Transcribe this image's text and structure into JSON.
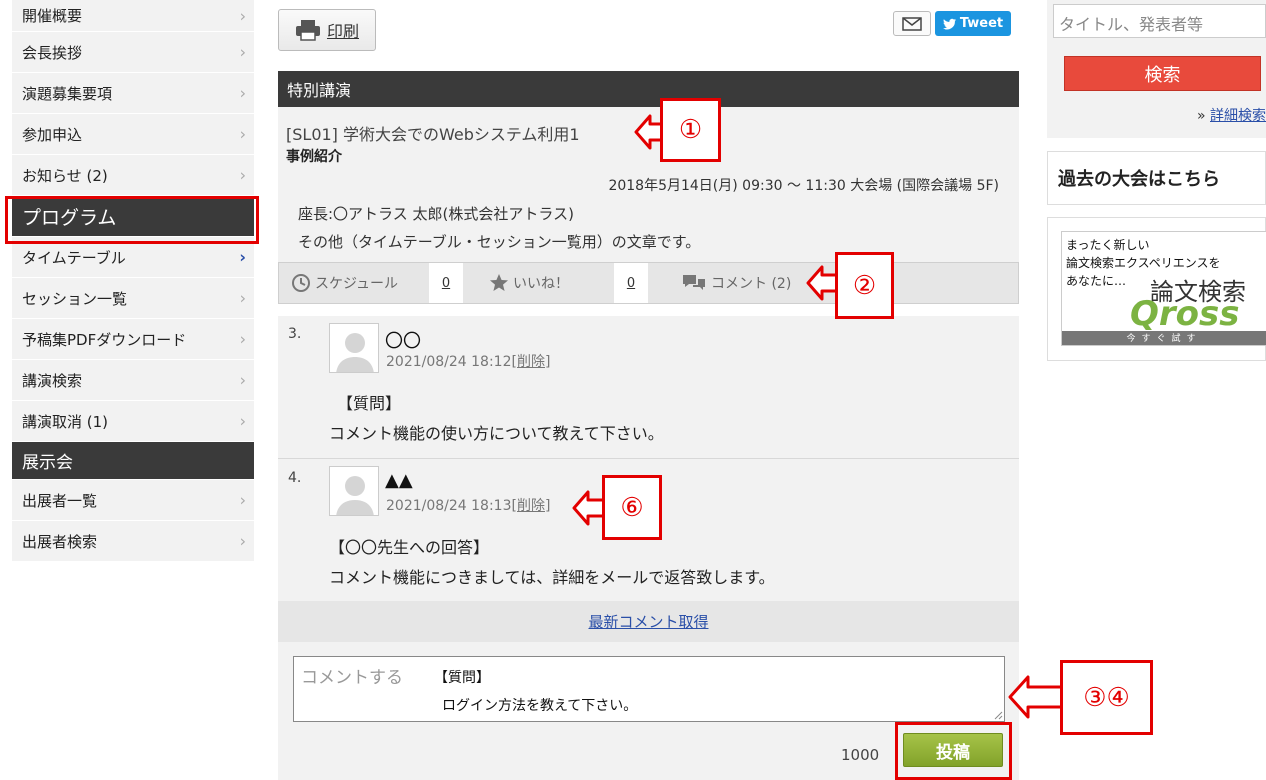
{
  "sidebar": {
    "items": [
      {
        "label": "開催概要"
      },
      {
        "label": "会長挨拶"
      },
      {
        "label": "演題募集要項"
      },
      {
        "label": "参加申込"
      },
      {
        "label": "お知らせ (2)"
      },
      {
        "label": "プログラム"
      },
      {
        "label": "タイムテーブル"
      },
      {
        "label": "セッション一覧"
      },
      {
        "label": "予稿集PDFダウンロード"
      },
      {
        "label": "講演検索"
      },
      {
        "label": "講演取消 (1)"
      }
    ],
    "section_label": "展示会",
    "exhibit_items": [
      {
        "label": "出展者一覧"
      },
      {
        "label": "出展者検索"
      }
    ]
  },
  "toolbar": {
    "print_label": "印刷",
    "tweet_label": "Tweet"
  },
  "session": {
    "header": "特別講演",
    "title": "[SL01] 学術大会でのWebシステム利用1",
    "subtitle": "事例紹介",
    "datetime": "2018年5月14日(月) 09:30 ～ 11:30 大会場 (国際会議場 5F)",
    "chair": "座長:〇アトラス 太郎(株式会社アトラス)",
    "other": "その他（タイムテーブル・セッション一覧用）の文章です。"
  },
  "actions": {
    "schedule_label": "スケジュール",
    "schedule_count": "0",
    "like_label": "いいね！",
    "like_count": "0",
    "comment_label": "コメント (2)"
  },
  "comments": [
    {
      "num": "3.",
      "name": "〇〇",
      "date": "2021/08/24 18:12",
      "delete_label": "[削除]",
      "line1": "【質問】",
      "line2": "コメント機能の使い方について教えて下さい。"
    },
    {
      "num": "4.",
      "name": "▲▲",
      "date": "2021/08/24 18:13",
      "delete_label": "[削除]",
      "line1": "【〇〇先生への回答】",
      "line2": "コメント機能につきましては、詳細をメールで返答致します。"
    }
  ],
  "latest_label": "最新コメント取得",
  "form": {
    "placeholder": "コメントする",
    "value_line1": "【質問】",
    "value_line2": "ログイン方法を教えて下さい。",
    "char_count": "1000",
    "post_label": "投稿"
  },
  "right": {
    "search_placeholder": "タイトル、発表者等",
    "search_button": "検索",
    "advanced_prefix": "»",
    "advanced_link": "詳細検索",
    "past_label": "過去の大会はこちら",
    "banner_line1": "まったく新しい",
    "banner_line2": "論文検索エクスペリエンスを",
    "banner_line3": "あなたに…",
    "banner_big": "論文検索",
    "banner_logo": "Qross",
    "banner_footer": "今すぐ試す"
  },
  "annotations": {
    "a1": "①",
    "a2": "②",
    "a34": "③④",
    "a6": "⑥"
  },
  "colors": {
    "accent_red": "#e30000",
    "dark_header": "#3a3a3a",
    "link_blue": "#2a4fa8",
    "post_green": "#8aab2e",
    "search_red": "#e84a3c",
    "tweet_blue": "#1b95e0"
  }
}
